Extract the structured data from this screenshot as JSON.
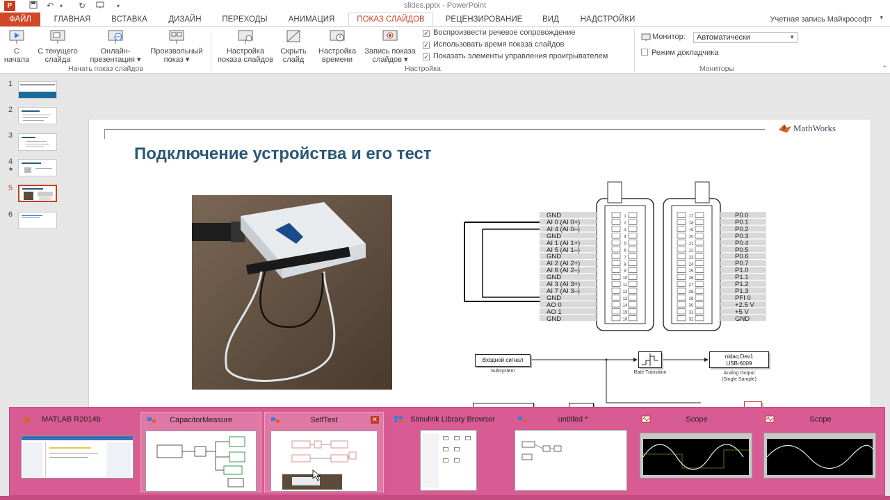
{
  "titlebar": {
    "app_icon": "P",
    "title": "slides.pptx - PowerPoint"
  },
  "tabs": [
    {
      "label": "ФАЙЛ"
    },
    {
      "label": "ГЛАВНАЯ"
    },
    {
      "label": "ВСТАВКА"
    },
    {
      "label": "ДИЗАЙН"
    },
    {
      "label": "ПЕРЕХОДЫ"
    },
    {
      "label": "АНИМАЦИЯ"
    },
    {
      "label": "ПОКАЗ СЛАЙДОВ"
    },
    {
      "label": "РЕЦЕНЗИРОВАНИЕ"
    },
    {
      "label": "ВИД"
    },
    {
      "label": "НАДСТРОЙКИ"
    }
  ],
  "account": "Учетная запись Майкрософт",
  "ribbon": {
    "buttons": [
      {
        "line1": "С",
        "line2": "начала"
      },
      {
        "line1": "С текущего",
        "line2": "слайда"
      },
      {
        "line1": "Онлайн-",
        "line2": "презентация ▾"
      },
      {
        "line1": "Произвольный",
        "line2": "показ ▾"
      },
      {
        "line1": "Настройка",
        "line2": "показа слайдов"
      },
      {
        "line1": "Скрыть",
        "line2": "слайд"
      },
      {
        "line1": "Настройка",
        "line2": "времени"
      },
      {
        "line1": "Запись показа",
        "line2": "слайдов ▾"
      }
    ],
    "groups": [
      "Начать показ слайдов",
      "Настройка",
      "Мониторы"
    ],
    "checkboxes": [
      {
        "label": "Воспроизвести речевое сопровождение",
        "checked": true
      },
      {
        "label": "Использовать время показа слайдов",
        "checked": true
      },
      {
        "label": "Показать элементы управления проигрывателем",
        "checked": true
      }
    ],
    "monitor_label": "Монитор:",
    "monitor_value": "Автоматически",
    "presenter_view": {
      "label": "Режим докладчика",
      "checked": false
    }
  },
  "thumbnails": {
    "numbers": [
      "1",
      "2",
      "3",
      "4",
      "5",
      "6"
    ],
    "star": "★",
    "active": "5"
  },
  "slide": {
    "logo": "MathWorks",
    "title": "Подключение устройства и его тест",
    "pins_left": [
      "GND",
      "AI 0 (AI 0+)",
      "AI 4 (AI 0–)",
      "GND",
      "AI 1 (AI 1+)",
      "AI 5 (AI 1–)",
      "GND",
      "AI 2 (AI 2+)",
      "AI 6 (AI 2–)",
      "GND",
      "AI 3 (AI 3+)",
      "AI 7 (AI 3–)",
      "GND",
      "AO 0",
      "AO 1",
      "GND"
    ],
    "pins_right": [
      "P0.0",
      "P0.1",
      "P0.2",
      "P0.3",
      "P0.4",
      "P0.5",
      "P0.6",
      "P0.7",
      "P1.0",
      "P1.1",
      "P1.2",
      "P1.3",
      "PFI 0",
      "+2.5 V",
      "+5 V",
      "GND"
    ],
    "pin_numbers_left": [
      "1",
      "2",
      "3",
      "4",
      "5",
      "6",
      "7",
      "8",
      "9",
      "10",
      "11",
      "12",
      "13",
      "14",
      "15",
      "16"
    ],
    "pin_numbers_right": [
      "17",
      "18",
      "19",
      "20",
      "21",
      "22",
      "23",
      "24",
      "25",
      "26",
      "27",
      "28",
      "29",
      "30",
      "31",
      "32"
    ],
    "simulink": {
      "input_block": "Входной сигнал",
      "input_caption": "Subsystem",
      "rate_caption": "Rate Transition",
      "output_block_line1": "nidaq Dev1",
      "output_block_line2": "USB-6009",
      "output_caption_line1": "Analog Output",
      "output_caption_line2": "(Single Sample)"
    }
  },
  "taskbar_windows": [
    {
      "title": "MATLAB R2014b"
    },
    {
      "title": "CapacitorMeasure"
    },
    {
      "title": "SelfTest"
    },
    {
      "title": "Simulink Library Browser"
    },
    {
      "title": "untitled *"
    },
    {
      "title": "Scope"
    },
    {
      "title": "Scope"
    }
  ],
  "colors": {
    "accent": "#d24726",
    "slide_title": "#2b5876",
    "taskswitch_bg": "#d95b93"
  }
}
